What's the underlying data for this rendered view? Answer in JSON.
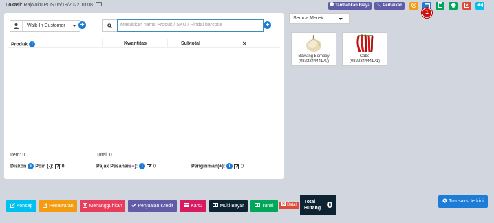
{
  "topbar": {
    "location_label": "Lokasi:",
    "location_name": "Rajolaku POS",
    "datetime": "05/19/2022 10:08",
    "add_expense_label": "Tambahkan Biaya",
    "repair_label": "Perbaikan",
    "badge_number": "1"
  },
  "pos": {
    "customer_value": "Walk-In Customer",
    "search_placeholder": "Masukkan nama Produk / SKU / Pindai barcode",
    "col_product": "Produk",
    "col_quantity": "Kwantitas",
    "col_subtotal": "Subtotal",
    "col_remove": "✕",
    "items_label": "Item:",
    "items_value": "0",
    "total_label": "Total:",
    "total_value": "0",
    "discount_label": "Diskon",
    "points_label": "Poin (-):",
    "discount_value": "0",
    "tax_label": "Pajak Pesanan(+):",
    "tax_value": "0",
    "shipping_label": "Pengiriman(+):",
    "shipping_value": "0"
  },
  "catalog": {
    "brand_filter": "Semua Merek",
    "products": [
      {
        "name": "Bawang Bombay",
        "sku": "(082284444170)"
      },
      {
        "name": "Cabe",
        "sku": "(082284444171)"
      }
    ]
  },
  "actions": {
    "draft": "Konsep",
    "quotation": "Penawaran",
    "suspend": "Menangguhkan",
    "credit_sale": "Penjualan Kredit",
    "card": "Kartu",
    "multi_pay": "Multi Bayar",
    "cash": "Tunai",
    "cancel": "Batal",
    "total_due_label_1": "Total",
    "total_due_label_2": "Hutang",
    "total_due_value": "0",
    "recent_transactions": "Transaksi terkini"
  },
  "colors": {
    "background": "#d2d6de",
    "primary": "#1d7dd6",
    "purple": "#605ca8",
    "orange": "#f39c12",
    "green": "#00a65a",
    "red": "#dd4b39",
    "cyan": "#00c0ef",
    "pink": "#e83e5c",
    "dark": "#0d2331"
  }
}
